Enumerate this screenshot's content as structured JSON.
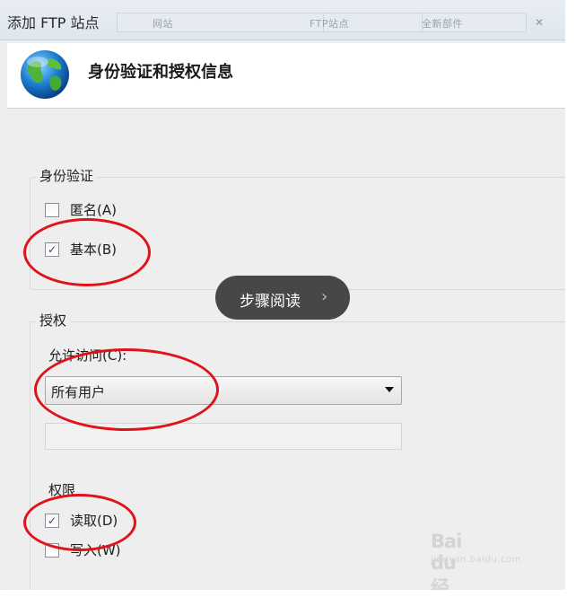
{
  "window": {
    "title": "添加 FTP 站点",
    "bg_crumbs": [
      "网站",
      "FTP站点",
      "全新部件"
    ]
  },
  "header": {
    "title": "身份验证和授权信息",
    "icon": "globe-icon"
  },
  "authentication": {
    "group_label": "身份验证",
    "anonymous": {
      "label": "匿名(A)",
      "checked": false
    },
    "basic": {
      "label": "基本(B)",
      "checked": true
    }
  },
  "authorization": {
    "group_label": "授权",
    "allow_access_label": "允许访问(C):",
    "allow_access_value": "所有用户",
    "text_field_value": "",
    "permissions_label": "权限",
    "read": {
      "label": "读取(D)",
      "checked": true
    },
    "write": {
      "label": "写入(W)",
      "checked": false
    }
  },
  "overlay": {
    "pill_text": "步骤阅读",
    "pill_icon": "chevron-right-icon"
  },
  "watermark": {
    "logo": "Bai du 经验",
    "sub": "jingyan.baidu.com"
  },
  "colors": {
    "annotation_red": "#e0121a",
    "pill_bg": "#303030",
    "header_bg": "#ffffff",
    "content_bg": "#eeeeee"
  }
}
